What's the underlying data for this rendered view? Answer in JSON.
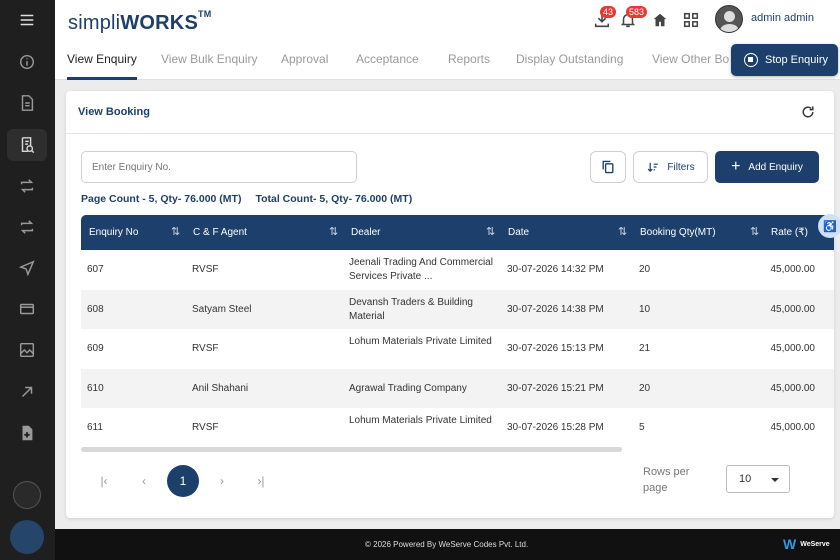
{
  "header": {
    "logo_main": "simpli",
    "logo_bold": "WORKS",
    "logo_tm": "TM",
    "download_badge": "43",
    "notification_badge": "583",
    "user_name": "admin admin"
  },
  "tabs": [
    "View Enquiry",
    "View Bulk Enquiry",
    "Approval",
    "Acceptance",
    "Reports",
    "Display Outstanding",
    "View Other Bo"
  ],
  "stop_enquiry_label": "Stop Enquiry",
  "card": {
    "title": "View Booking",
    "search_placeholder": "Enter Enquiry No.",
    "filters_label": "Filters",
    "add_label": "Add Enquiry",
    "page_count": "Page Count - 5, Qty- 76.000 (MT)",
    "total_count": "Total Count- 5, Qty- 76.000 (MT)"
  },
  "table": {
    "columns": [
      "Enquiry No",
      "C & F Agent",
      "Dealer",
      "Date",
      "Booking Qty(MT)",
      "Rate (₹)"
    ],
    "rows": [
      {
        "enquiry_no": "607",
        "agent": "RVSF",
        "dealer": "Jeenali Trading And Commercial Services Private ...",
        "date": "30-07-2026 14:32 PM",
        "qty": "20",
        "rate": "45,000.00"
      },
      {
        "enquiry_no": "608",
        "agent": "Satyam Steel",
        "dealer": "Devansh Traders & Building Material",
        "date": "30-07-2026 14:38 PM",
        "qty": "10",
        "rate": "45,000.00"
      },
      {
        "enquiry_no": "609",
        "agent": "RVSF",
        "dealer": "Lohum Materials Private Limited",
        "date": "30-07-2026 15:13 PM",
        "qty": "21",
        "rate": "45,000.00"
      },
      {
        "enquiry_no": "610",
        "agent": "Anil Shahani",
        "dealer": "Agrawal Trading Company",
        "date": "30-07-2026 15:21 PM",
        "qty": "20",
        "rate": "45,000.00"
      },
      {
        "enquiry_no": "611",
        "agent": "RVSF",
        "dealer": "Lohum Materials Private Limited",
        "date": "30-07-2026 15:28 PM",
        "qty": "5",
        "rate": "45,000.00"
      }
    ]
  },
  "pagination": {
    "current_page": "1",
    "rows_per_page_label": "Rows per page",
    "rows_per_page": "10"
  },
  "footer": {
    "text": "© 2026 Powered By WeServe Codes Pvt. Ltd.",
    "logo": "WeServe"
  },
  "accessibility_glyph": "♿"
}
